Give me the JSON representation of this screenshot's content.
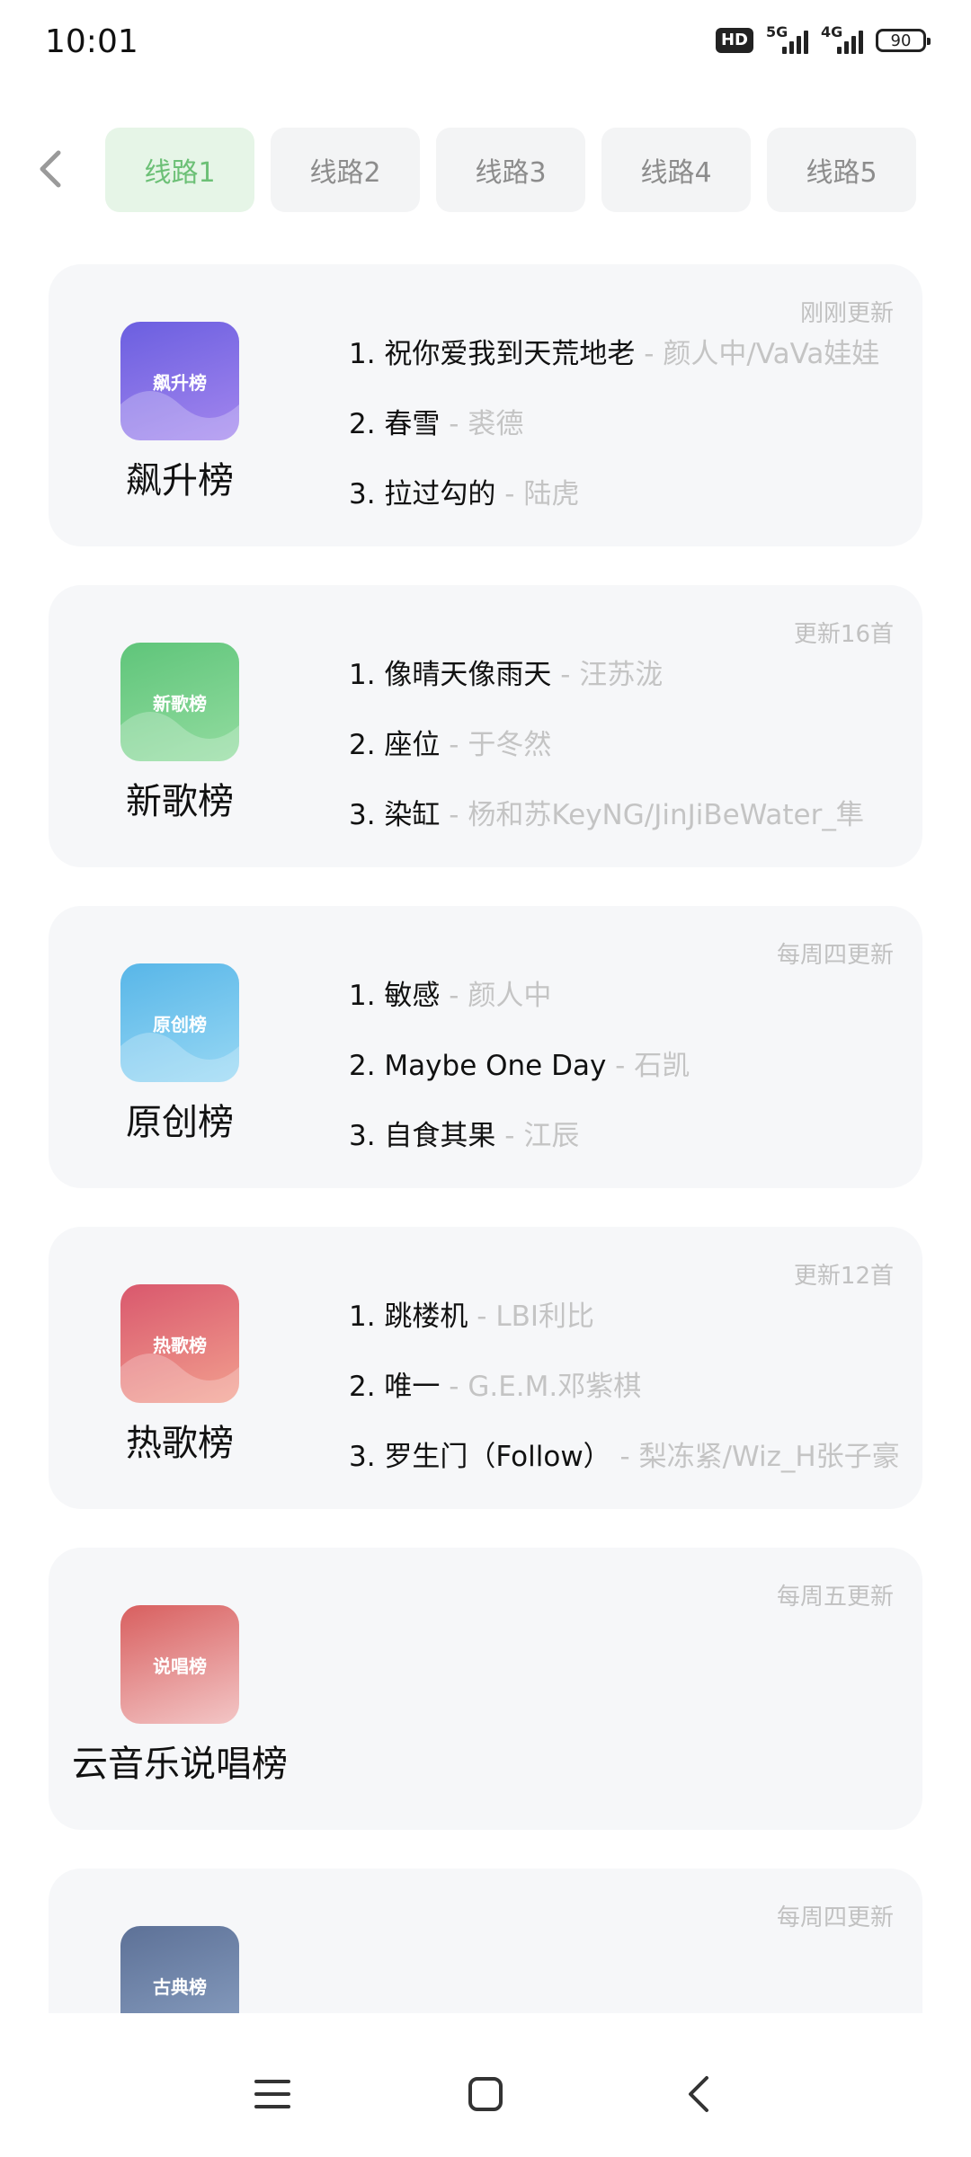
{
  "status": {
    "time": "10:01",
    "hd": "HD",
    "net1": "5G",
    "net2": "4G",
    "battery": "90"
  },
  "routes": {
    "tabs": [
      "线路1",
      "线路2",
      "线路3",
      "线路4",
      "线路5"
    ],
    "active_index": 0
  },
  "charts": [
    {
      "name": "飙升榜",
      "cover_text": "飙升榜",
      "update": "刚刚更新",
      "colors": [
        "#6b5fe0",
        "#a386ee"
      ],
      "tracks": [
        {
          "title": "1. 祝你爱我到天荒地老",
          "artist": " - 颜人中/VaVa娃娃"
        },
        {
          "title": "2. 春雪",
          "artist": " - 裘德"
        },
        {
          "title": "3. 拉过勾的",
          "artist": " - 陆虎"
        }
      ]
    },
    {
      "name": "新歌榜",
      "cover_text": "新歌榜",
      "update": "更新16首",
      "colors": [
        "#5fc57a",
        "#93dca0"
      ],
      "tracks": [
        {
          "title": "1. 像晴天像雨天",
          "artist": " - 汪苏泷"
        },
        {
          "title": "2. 座位",
          "artist": " - 于冬然"
        },
        {
          "title": "3. 染缸",
          "artist": " - 杨和苏KeyNG/JinJiBeWater_隼"
        }
      ]
    },
    {
      "name": "原创榜",
      "cover_text": "原创榜",
      "update": "每周四更新",
      "colors": [
        "#58b6e8",
        "#98d8f4"
      ],
      "tracks": [
        {
          "title": "1. 敏感",
          "artist": " - 颜人中"
        },
        {
          "title": "2. Maybe One Day",
          "artist": " - 石凯"
        },
        {
          "title": "3. 自食其果",
          "artist": " - 江辰"
        }
      ]
    },
    {
      "name": "热歌榜",
      "cover_text": "热歌榜",
      "update": "更新12首",
      "colors": [
        "#d9586d",
        "#f2a08f"
      ],
      "tracks": [
        {
          "title": "1. 跳楼机",
          "artist": " - LBI利比"
        },
        {
          "title": "2. 唯一",
          "artist": " - G.E.M.邓紫棋"
        },
        {
          "title": "3. 罗生门（Follow）",
          "artist": " - 梨冻紧/Wiz_H张子豪"
        }
      ]
    },
    {
      "name": "云音乐说唱榜",
      "cover_text": "说唱榜",
      "update": "每周五更新",
      "colors": [
        "#d85f5f",
        "#f3c6c6"
      ],
      "tracks": []
    },
    {
      "name": "",
      "cover_text": "古典榜",
      "update": "每周四更新",
      "colors": [
        "#5d7197",
        "#8aa0c2"
      ],
      "tracks": []
    }
  ],
  "icons": {
    "back": "chevron-left-icon",
    "menu": "menu-icon",
    "home": "home-icon",
    "nav_back": "nav-back-icon"
  }
}
